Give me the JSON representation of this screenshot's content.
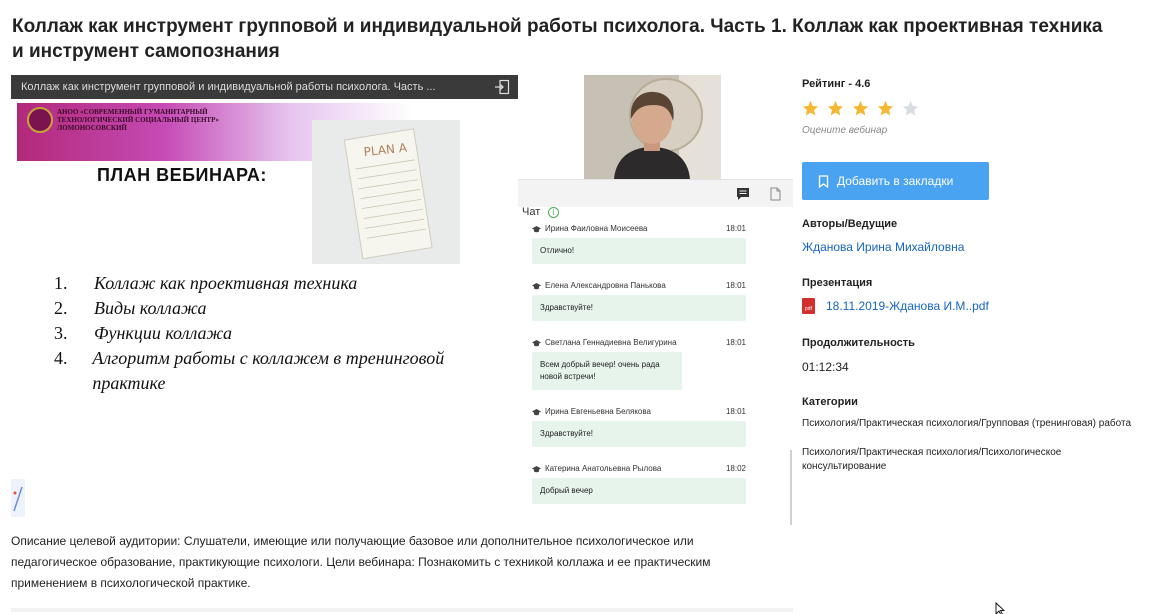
{
  "page": {
    "title": "Коллаж как инструмент групповой и индивидуальной работы психолога. Часть 1. Коллаж как проективная техника и инструмент самопознания"
  },
  "player": {
    "slide_bar_title": "Коллаж как инструмент групповой и индивидуальной работы психолога. Часть ...",
    "slide": {
      "banner_text": "АНОО «СОВРЕМЕННЫЙ ГУМАНИТАРНЫЙ ТЕХНОЛОГИЧЕСКИЙ СОЦИАЛЬНЫЙ ЦЕНТР» ЛОМОНОСОВСКИЙ",
      "paper_title": "PLAN A",
      "plan_title": "ПЛАН ВЕБИНАРА:",
      "items": [
        {
          "num": "1.",
          "text": "Коллаж как проективная техника"
        },
        {
          "num": "2.",
          "text": "Виды коллажа"
        },
        {
          "num": "3.",
          "text": "Функции коллажа"
        },
        {
          "num": "4.",
          "text": "Алгоритм работы с коллажем в тренинговой практике"
        }
      ]
    },
    "chat": {
      "label": "Чат",
      "messages": [
        {
          "author": "Ирина Фаиловна Моисеева",
          "time": "18:01",
          "text": "Отлично!"
        },
        {
          "author": "Елена Александровна Панькова",
          "time": "18:01",
          "text": "Здравствуйте!"
        },
        {
          "author": "Светлана Геннадиевна Велигурина",
          "time": "18:01",
          "text": "Всем добрый вечер! очень рада новой встречи!"
        },
        {
          "author": "Ирина Евгеньевна Белякова",
          "time": "18:01",
          "text": "Здравствуйте!"
        },
        {
          "author": "Катерина Анатольевна Рылова",
          "time": "18:02",
          "text": "Добрый вечер"
        }
      ]
    }
  },
  "sidebar": {
    "rating_label": "Рейтинг - 4.6",
    "rating": {
      "value": 4,
      "max": 5,
      "filled_color": "#f5b731",
      "empty_color": "#d9dde3"
    },
    "rate_hint": "Оцените вебинар",
    "bookmark_label": "Добавить в закладки",
    "accent_color": "#4aa3f0",
    "authors_label": "Авторы/Ведущие",
    "author": "Жданова Ирина Михайловна",
    "presentation_label": "Презентация",
    "presentation_file": "18.11.2019-Жданова И.М..pdf",
    "pdf_icon_text": "pdf",
    "duration_label": "Продолжительность",
    "duration": "01:12:34",
    "categories_label": "Категории",
    "categories": [
      "Психология/Практическая психология/Групповая (тренинговая) работа",
      "Психология/Практическая психология/Психологическое консультирование"
    ]
  },
  "description": "Описание целевой аудитории: Слушатели, имеющие или получающие базовое или дополнительное психологическое или педагогическое образование, практикующие психологи. Цели вебинара: Познакомить с техникой коллажа и ее практическим применением в психологической практике."
}
